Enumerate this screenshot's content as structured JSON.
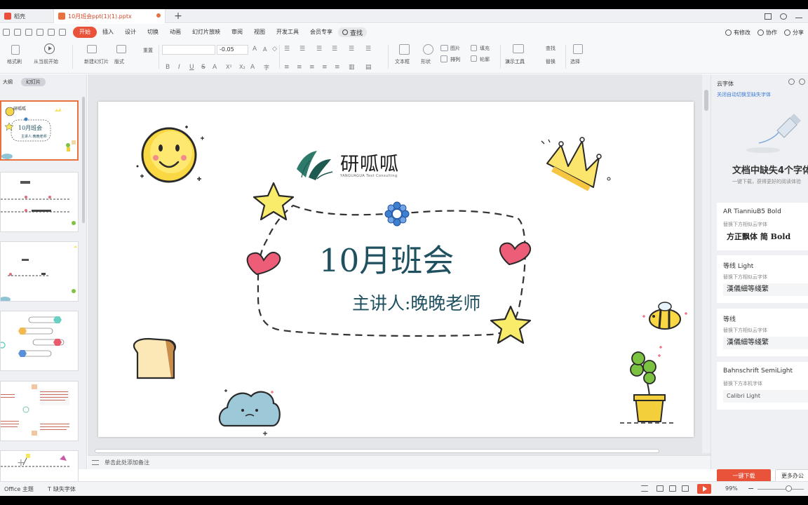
{
  "tabs": [
    {
      "label": "稻壳"
    },
    {
      "label": "10月班会ppt(1)(1).pptx"
    }
  ],
  "menu": {
    "items": [
      "开始",
      "插入",
      "设计",
      "切换",
      "动画",
      "幻灯片放映",
      "审阅",
      "视图",
      "开发工具",
      "会员专享"
    ],
    "active": "开始",
    "search": "查找",
    "right": [
      "有修改",
      "协作",
      "分享"
    ]
  },
  "ribbon": {
    "format_painter": "格式刷",
    "from_current": "从当前开始",
    "new_slide": "新建幻灯片",
    "layout": "版式",
    "reset": "重置",
    "font_size": "-0.05",
    "textbox": "文本框",
    "shape": "形状",
    "image": "图片",
    "fill": "填充",
    "arrange": "排列",
    "outline": "轮廓",
    "presenter_tools": "演示工具",
    "find": "查找",
    "replace": "替换",
    "select": "选择",
    "format_buttons": [
      "B",
      "I",
      "U",
      "S",
      "A",
      "X²",
      "X₂",
      "A",
      "字"
    ]
  },
  "left_panel": {
    "tabs": [
      "大纲",
      "幻灯片"
    ],
    "selected_tab": "幻灯片",
    "thumb1_title": "10月班会",
    "thumb1_sub": "主讲人:晚晚老师",
    "thumb1_logo": "研呱呱"
  },
  "slide": {
    "logo": "研呱呱",
    "logo_sub": "YANGUAGUA Text Consulting",
    "title": "10月班会",
    "subtitle": "主讲人:晚晚老师"
  },
  "notes_placeholder": "单击此处添加备注",
  "right_panel": {
    "header": "云字体",
    "link": "关闭自动切换至缺失字体",
    "title": "文档中缺失4个字体",
    "desc": "一键下载，获得更好的阅读体验",
    "fonts": [
      {
        "name": "AR TianniuB5 Bold",
        "hint": "替换下方相似云字体",
        "sample": "方正飘体 简 Bold"
      },
      {
        "name": "等线 Light",
        "hint": "替换下方相似云字体",
        "sample": "漢儀細等綫繁"
      },
      {
        "name": "等线",
        "hint": "替换下方相似云字体",
        "sample": "漢儀細等綫繁"
      },
      {
        "name": "Bahnschrift SemiLight",
        "hint": "替换下方本机字体",
        "sample": "Calibri Light"
      }
    ],
    "download_button": "一键下载",
    "more_button": "更多办公"
  },
  "status": {
    "theme": "Office 主题",
    "missing_fonts": "缺失字体",
    "zoom": "99%"
  },
  "colors": {
    "accent": "#e8533a",
    "title_text": "#1f5060"
  }
}
